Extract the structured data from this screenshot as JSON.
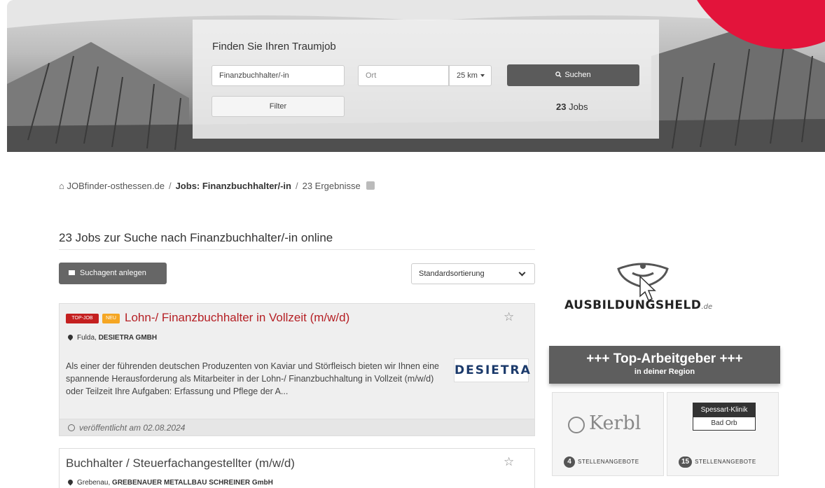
{
  "search": {
    "title": "Finden Sie Ihren Traumjob",
    "what_value": "Finanzbuchhalter/-in",
    "ort_placeholder": "Ort",
    "radius": "25 km",
    "search_label": "Suchen",
    "filter_label": "Filter",
    "count_number": "23",
    "count_suffix": " Jobs"
  },
  "breadcrumb": {
    "home": "JOBfinder-osthessen.de",
    "current": "Jobs: Finanzbuchhalter/-in",
    "results": "23 Ergebnisse"
  },
  "results": {
    "heading": "23 Jobs zur Suche nach Finanzbuchhalter/-in online",
    "agent_button": "Suchagent anlegen",
    "sort_value": "Standardsortierung"
  },
  "jobs": [
    {
      "badge_top": "TOP-JOB",
      "badge_new": "NEU",
      "title": "Lohn-/ Finanzbuchhalter in Vollzeit (m/w/d)",
      "city": "Fulda, ",
      "company": "DESIETRA GMBH",
      "description": "Als einer der führenden deutschen Produzenten von Kaviar und Störfleisch bieten wir Ihnen eine spannende Herausforderung als  Mitarbeiter in der Lohn-/ Finanzbuchhaltung in Vollzeit (m/w/d) oder Teilzeit Ihre Aufgaben: Erfassung und Pflege der A...",
      "logo_text": "DESIETRA",
      "published": "veröffentlicht am 02.08.2024"
    },
    {
      "title": "Buchhalter / Steuerfachangestellter (m/w/d)",
      "city": "Grebenau, ",
      "company": "GREBENAUER METALLBAU SCHREINER GmbH"
    }
  ],
  "sidebar": {
    "ausbildung_word": "AUSBILDUNGSHELD",
    "ausbildung_suffix": ".de",
    "employers_title": "+++ Top-Arbeitgeber +++",
    "employers_subtitle": "in deiner Region",
    "employers": [
      {
        "name": "Kerbl",
        "count": "4",
        "label": "STELLENANGEBOTE"
      },
      {
        "name_top": "Spessart-Klinik",
        "name_bottom": "Bad Orb",
        "count": "15",
        "label": "STELLENANGEBOTE"
      }
    ]
  },
  "colors": {
    "accent_red": "#e3143b",
    "job_title_red": "#b51f24",
    "button_gray": "#5b5b5b"
  }
}
